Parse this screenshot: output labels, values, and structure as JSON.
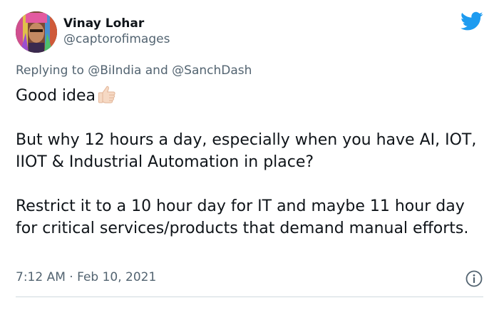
{
  "author": {
    "name": "Vinay Lohar",
    "handle": "@captorofimages",
    "avatar_icon": "user-avatar-photo"
  },
  "brand": {
    "icon": "twitter-bird-icon",
    "color": "#1d9bf0"
  },
  "reply": {
    "prefix": "Replying to",
    "mention_1": "@BiIndia",
    "conjunction": "and",
    "mention_2": "@SanchDash"
  },
  "tweet": {
    "line_1": "Good idea",
    "line_1_emoji": "thumbs-up-icon",
    "paragraph_2": "But why 12 hours a day, especially when you have AI, IOT, IIOT & Industrial Automation in place?",
    "paragraph_3": "Restrict it to a 10 hour day for IT and maybe 11 hour day for critical services/products that demand manual efforts."
  },
  "meta": {
    "time": "7:12 AM",
    "separator": "·",
    "date": "Feb 10, 2021",
    "info_icon": "info-icon"
  },
  "colors": {
    "text": "#0f1419",
    "secondary": "#536471",
    "divider": "#cfd9de"
  }
}
